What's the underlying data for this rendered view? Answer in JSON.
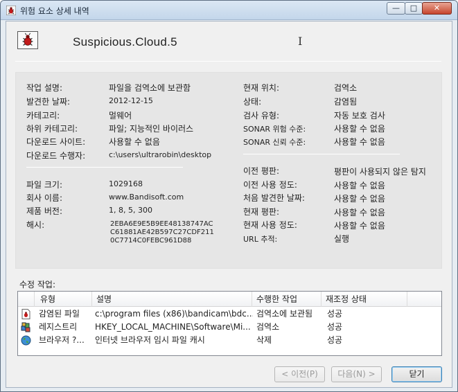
{
  "window": {
    "title": "위험 요소 상세 내역"
  },
  "header": {
    "threat_name": "Suspicious.Cloud.5"
  },
  "details": {
    "left1": [
      {
        "label": "작업 설명:",
        "value": "파일을 검역소에 보관함"
      },
      {
        "label": "발견한 날짜:",
        "value": "2012-12-15"
      },
      {
        "label": "카테고리:",
        "value": "멀웨어"
      },
      {
        "label": "하위 카테고리:",
        "value": "파일; 지능적인 바이러스"
      },
      {
        "label": "다운로드 사이트:",
        "value": "사용할 수 없음"
      },
      {
        "label": "다운로드 수행자:",
        "value": "c:\\users\\ultrarobin\\desktop"
      }
    ],
    "left2": [
      {
        "label": "파일 크기:",
        "value": "1029168"
      },
      {
        "label": "회사 이름:",
        "value": "www.Bandisoft.com"
      },
      {
        "label": "제품 버전:",
        "value": "1, 8, 5, 300"
      }
    ],
    "hash": {
      "label": "해시:",
      "lines": [
        "2EBA6E9E5B9EE48138747AC",
        "C61881AE42B597C27CDF211",
        "0C7714C0FEBC961D88"
      ]
    },
    "right1": [
      {
        "label": "현재 위치:",
        "value": "검역소"
      },
      {
        "label": "상태:",
        "value": "감염됨"
      },
      {
        "label": "검사 유형:",
        "value": "자동 보호 검사"
      },
      {
        "label": "SONAR 위험 수준:",
        "value": "사용할 수 없음"
      },
      {
        "label": "SONAR 신뢰 수준:",
        "value": "사용할 수 없음"
      }
    ],
    "right2": [
      {
        "label": "이전 평판:",
        "value": "평판이 사용되지 않은 탐지"
      },
      {
        "label": "이전 사용 정도:",
        "value": "사용할 수 없음"
      },
      {
        "label": "처음 발견한 날짜:",
        "value": "사용할 수 없음"
      },
      {
        "label": "현재 평판:",
        "value": "사용할 수 없음"
      },
      {
        "label": "현재 사용 정도:",
        "value": "사용할 수 없음"
      },
      {
        "label": "URL 추적:",
        "value": "실행"
      }
    ]
  },
  "repair": {
    "label": "수정 작업:",
    "columns": [
      "유형",
      "설명",
      "수행한 작업",
      "재조정 상태"
    ],
    "rows": [
      {
        "type": "감염된 파일",
        "desc": "c:\\program files (x86)\\bandicam\\bdc...",
        "action": "검역소에 보관됨",
        "status": "성공"
      },
      {
        "type": "레지스트리",
        "desc": "HKEY_LOCAL_MACHINE\\Software\\Mi...",
        "action": "검역소",
        "status": "성공"
      },
      {
        "type": "브라우저 ?...",
        "desc": "인터넷 브라우저 임시 파일 캐시",
        "action": "삭제",
        "status": "성공"
      }
    ]
  },
  "buttons": {
    "prev": "< 이전(P)",
    "next": "다음(N) >",
    "close": "닫기"
  }
}
